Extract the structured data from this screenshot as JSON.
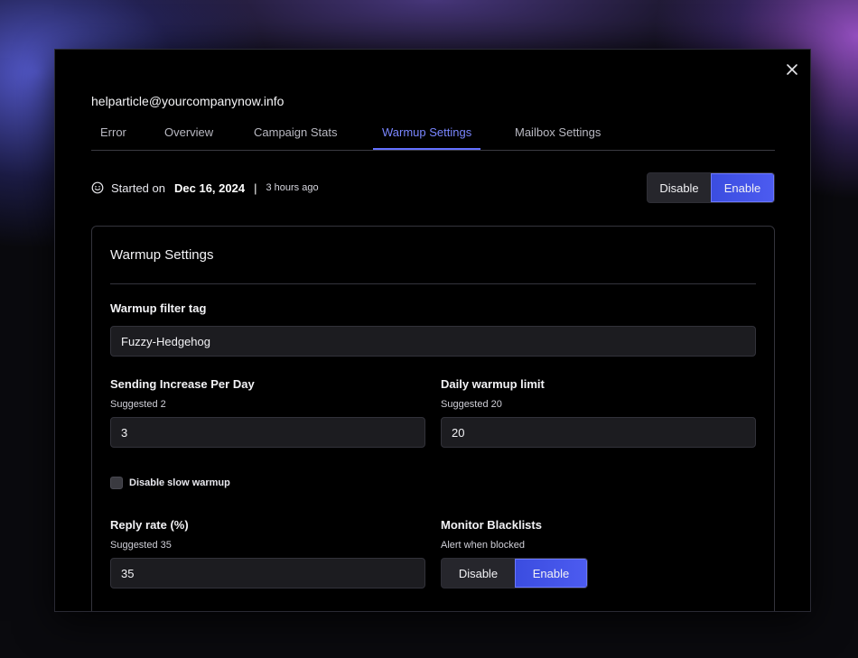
{
  "modal": {
    "account_email": "helparticle@yourcompanynow.info",
    "close_icon": "close-icon"
  },
  "tabs": [
    {
      "label": "Error",
      "active": false
    },
    {
      "label": "Overview",
      "active": false
    },
    {
      "label": "Campaign Stats",
      "active": false
    },
    {
      "label": "Warmup Settings",
      "active": true
    },
    {
      "label": "Mailbox Settings",
      "active": false
    }
  ],
  "status": {
    "icon": "smile-icon",
    "started_label": "Started on",
    "started_date": "Dec 16, 2024",
    "separator": "|",
    "relative_time": "3 hours ago"
  },
  "warmup_toggle": {
    "disable_label": "Disable",
    "enable_label": "Enable",
    "selected": "Enable"
  },
  "settings_panel": {
    "title": "Warmup Settings",
    "filter_tag": {
      "label": "Warmup filter tag",
      "value": "Fuzzy-Hedgehog"
    },
    "sending_increase": {
      "label": "Sending Increase Per Day",
      "hint": "Suggested 2",
      "value": "3"
    },
    "daily_limit": {
      "label": "Daily warmup limit",
      "hint": "Suggested 20",
      "value": "20"
    },
    "slow_warmup": {
      "label": "Disable slow warmup",
      "checked": false
    },
    "reply_rate": {
      "label": "Reply rate (%)",
      "hint": "Suggested 35",
      "value": "35"
    },
    "monitor_blacklists": {
      "label": "Monitor Blacklists",
      "hint": "Alert when blocked",
      "disable_label": "Disable",
      "enable_label": "Enable",
      "selected": "Enable"
    }
  },
  "colors": {
    "accent": "#4c5bf0",
    "active_tab": "#7a86ff",
    "background": "#000000",
    "input_bg": "#1c1c20"
  }
}
